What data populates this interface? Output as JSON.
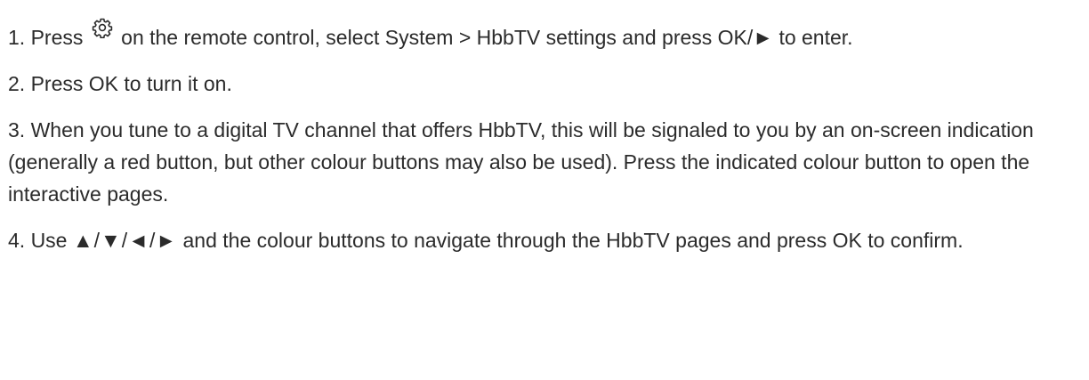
{
  "steps": [
    {
      "pre": "1. Press ",
      "icon": "gear-icon",
      "post": " on the remote control, select System > HbbTV settings and press OK/► to enter."
    },
    {
      "text": "2. Press OK to turn it on."
    },
    {
      "text": "3. When you tune to a digital TV channel that offers HbbTV, this will be signaled to you by an on-screen indication (generally a red button, but other colour buttons may also be used). Press the indicated colour button to open the interactive pages."
    },
    {
      "pre": "4. Use ",
      "arrows": "▲/▼/◄/►",
      "post": " and the colour buttons to navigate through the HbbTV pages and press OK to confirm."
    }
  ]
}
